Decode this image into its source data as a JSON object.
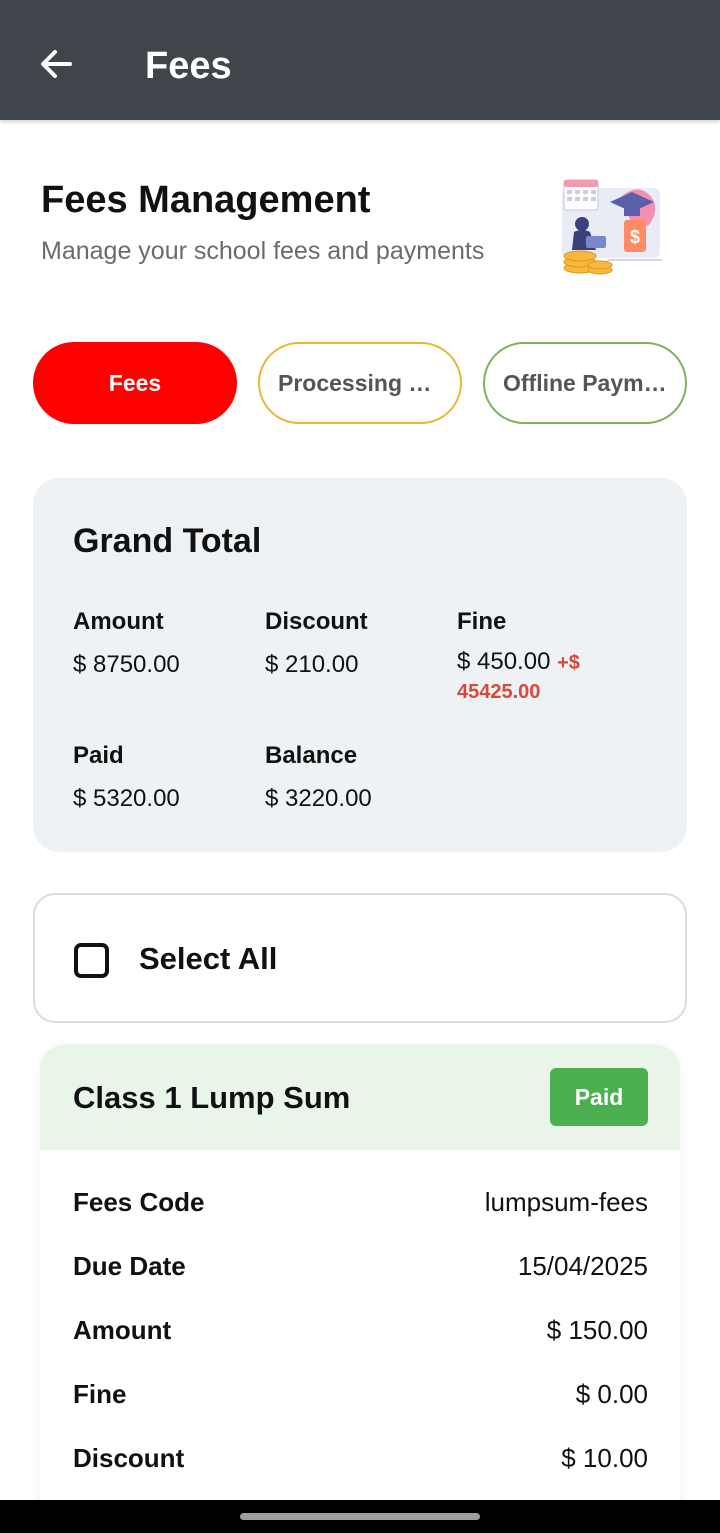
{
  "appbar": {
    "title": "Fees"
  },
  "header": {
    "title": "Fees Management",
    "subtitle": "Manage your school fees and payments"
  },
  "tabs": [
    {
      "label": "Fees",
      "active": true,
      "color": "#ff0000"
    },
    {
      "label": "Processing Fees",
      "active": false,
      "color": "#e5b935"
    },
    {
      "label": "Offline Payments",
      "active": false,
      "color": "#7cb25b"
    }
  ],
  "grand_total": {
    "title": "Grand Total",
    "amount_label": "Amount",
    "amount_value": "$ 8750.00",
    "discount_label": "Discount",
    "discount_value": "$ 210.00",
    "fine_label": "Fine",
    "fine_value": "$ 450.00",
    "fine_extra": "+$ 45425.00",
    "paid_label": "Paid",
    "paid_value": "$ 5320.00",
    "balance_label": "Balance",
    "balance_value": "$ 3220.00"
  },
  "select_all": {
    "label": "Select All",
    "checked": false
  },
  "fee_item": {
    "title": "Class 1 Lump Sum",
    "status": "Paid",
    "status_color": "#4caf50",
    "rows": [
      {
        "key": "Fees Code",
        "value": "lumpsum-fees"
      },
      {
        "key": "Due Date",
        "value": "15/04/2025"
      },
      {
        "key": "Amount",
        "value": "$ 150.00"
      },
      {
        "key": "Fine",
        "value": "$ 0.00"
      },
      {
        "key": "Discount",
        "value": "$ 10.00"
      }
    ]
  },
  "icons": {
    "back": "arrow-left-icon",
    "illustration": "fees-illustration",
    "checkbox": "checkbox-unchecked-icon"
  }
}
